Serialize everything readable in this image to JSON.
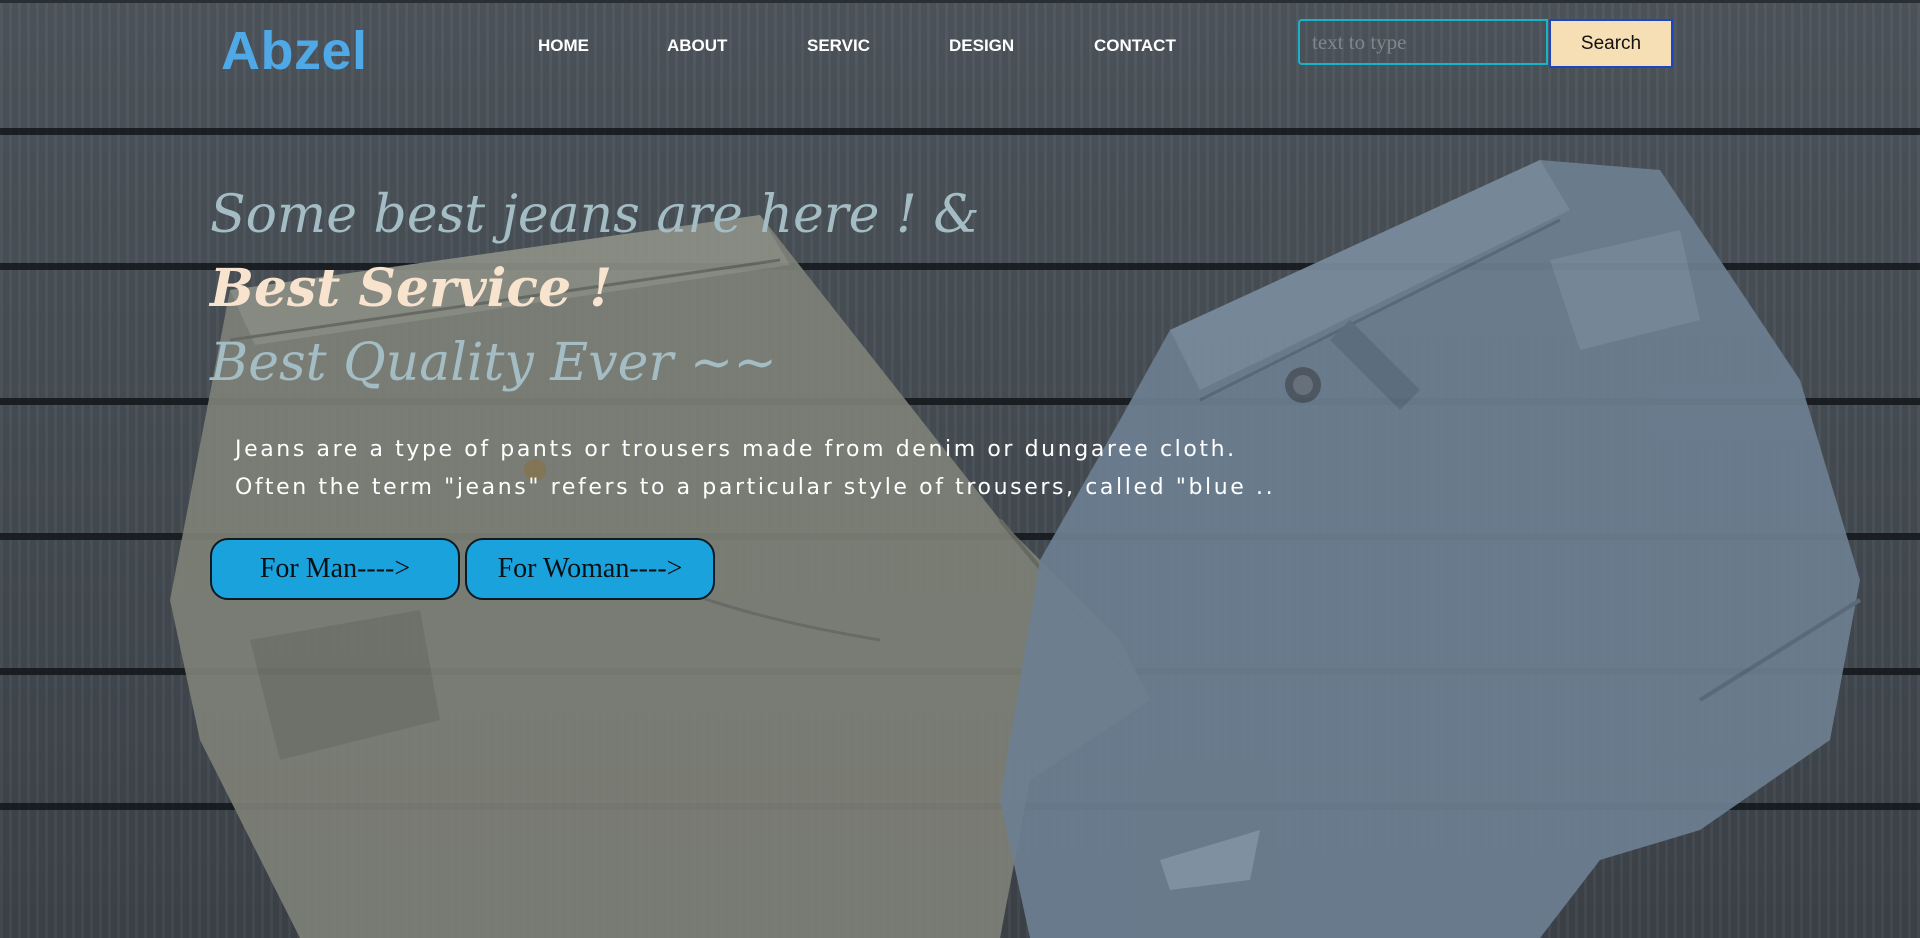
{
  "header": {
    "logo": "Abzel",
    "nav": [
      {
        "label": "HOME"
      },
      {
        "label": "ABOUT"
      },
      {
        "label": "SERVIC"
      },
      {
        "label": "DESIGN"
      },
      {
        "label": "CONTACT"
      }
    ],
    "search": {
      "placeholder": "text to type",
      "value": "",
      "button_label": "Search"
    }
  },
  "hero": {
    "title_line1": "Some best jeans are here ! &",
    "title_line2": "Best Service !",
    "title_line3": "Best Quality Ever ~~",
    "desc_line1": "Jeans are a type of pants or trousers made from denim or dungaree cloth.",
    "desc_line2": "Often the term \"jeans\" refers to a particular style of trousers, called \"blue ..",
    "cta_man": "For Man---->",
    "cta_woman": "For Woman---->"
  },
  "colors": {
    "logo": "#4fa9e6",
    "accent_button": "#1aa2dc",
    "search_button_bg": "#f7dfb5",
    "search_border": "#17b3c9",
    "highlight_text": "#f8e3cf"
  }
}
